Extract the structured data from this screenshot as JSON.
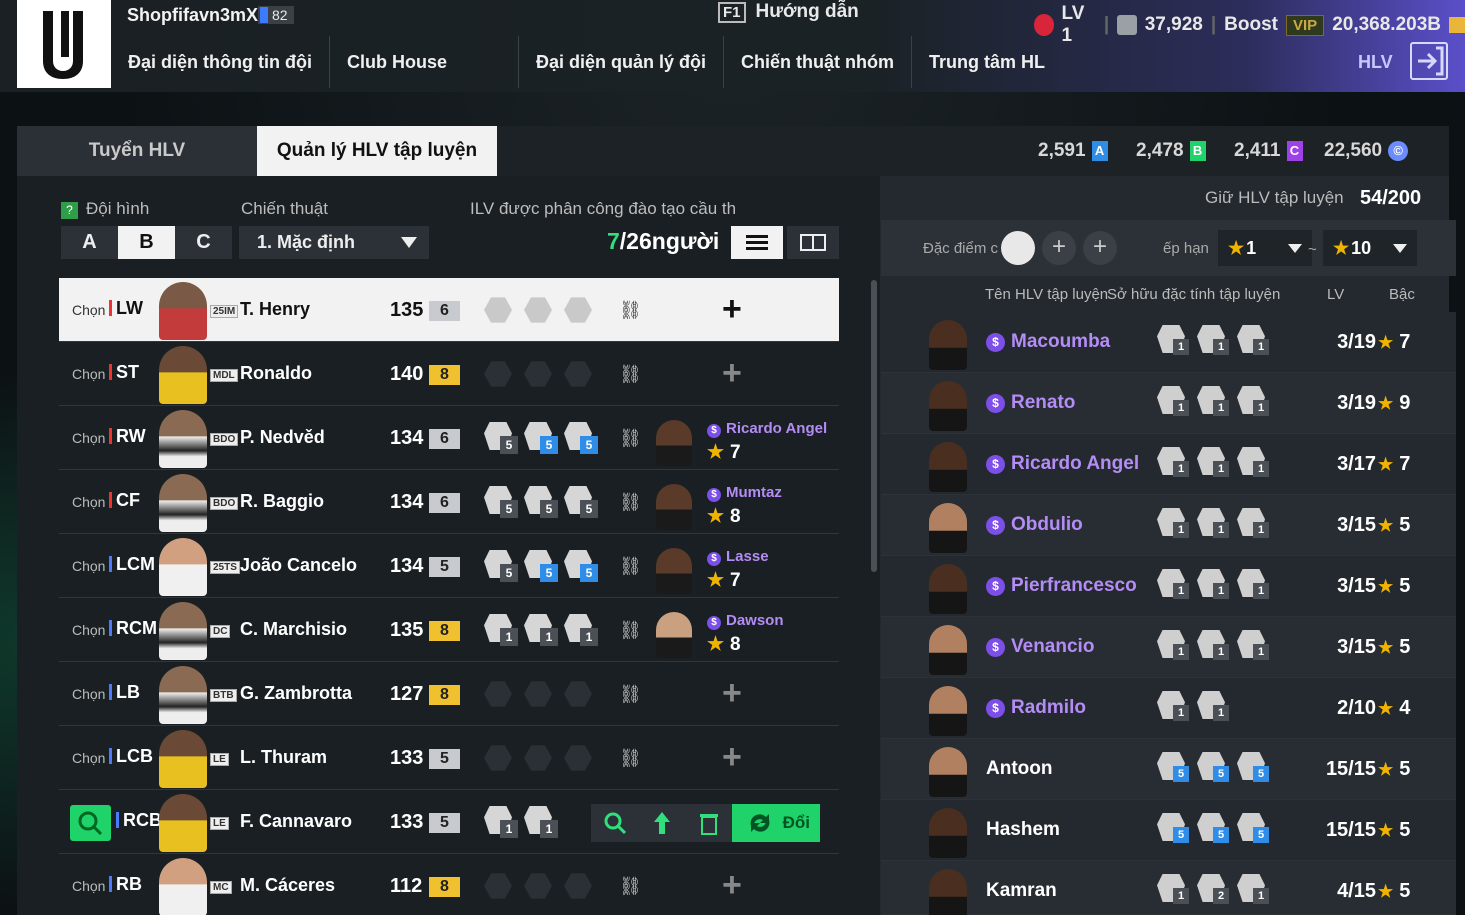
{
  "header": {
    "team_name": "Shopfifavn3mXr",
    "team_level": "82",
    "guide_key": "F1",
    "guide_label": "Hướng dẫn",
    "lv": "LV 1",
    "trophies": "37,928",
    "boost": "Boost",
    "vip": "VIP",
    "coins": "20,368.203B",
    "coach_label": "HLV"
  },
  "menu": [
    "Đại diện thông tin đội",
    "Club House",
    "Đại diện quản lý đội",
    "Chiến thuật nhóm",
    "Trung tâm HL"
  ],
  "tabs": [
    "Tuyển HLV",
    "Quản lý HLV tập luyện"
  ],
  "currencies": [
    {
      "value": "2,591",
      "code": "A",
      "color": "#2f8de8"
    },
    {
      "value": "2,478",
      "code": "B",
      "color": "#1fd26a"
    },
    {
      "value": "2,411",
      "code": "C",
      "color": "#a040e8"
    },
    {
      "value": "22,560",
      "code": "©",
      "color": "#6a8cff"
    }
  ],
  "left": {
    "formation_label": "Đội hình",
    "formation_help": "?",
    "tactic_label": "Chiến thuật",
    "assign_label": "ILV được phân công đào tạo cầu th",
    "formations": [
      "A",
      "B",
      "C"
    ],
    "tactic_value": "1. Mặc định",
    "count_current": "7",
    "count_rest": "/26người",
    "choose": "Chọn"
  },
  "rows": [
    {
      "pos": "LW",
      "season": "25IM",
      "name": "T. Henry",
      "ovr": "135",
      "lvl": "6"
    },
    {
      "pos": "ST",
      "season": "MDL",
      "name": "Ronaldo",
      "ovr": "140",
      "lvl": "8"
    },
    {
      "pos": "RW",
      "season": "BDO",
      "name": "P. Nedvěd",
      "ovr": "134",
      "lvl": "6",
      "traits": [
        "5",
        "5",
        "5"
      ],
      "coach": "Ricardo Angel",
      "cstar": "7"
    },
    {
      "pos": "CF",
      "season": "BDO",
      "name": "R. Baggio",
      "ovr": "134",
      "lvl": "6",
      "traits": [
        "5",
        "5",
        "5"
      ],
      "coach": "Mumtaz",
      "cstar": "8"
    },
    {
      "pos": "LCM",
      "season": "25TS",
      "name": "João Cancelo",
      "ovr": "134",
      "lvl": "5",
      "traits": [
        "5",
        "5",
        "5"
      ],
      "coach": "Lasse",
      "cstar": "7"
    },
    {
      "pos": "RCM",
      "season": "DC",
      "name": "C. Marchisio",
      "ovr": "135",
      "lvl": "8",
      "traits": [
        "1",
        "1",
        "1"
      ],
      "coach": "Dawson",
      "cstar": "8"
    },
    {
      "pos": "LB",
      "season": "BTB",
      "name": "G. Zambrotta",
      "ovr": "127",
      "lvl": "8"
    },
    {
      "pos": "LCB",
      "season": "LE",
      "name": "L. Thuram",
      "ovr": "133",
      "lvl": "5"
    },
    {
      "pos": "RCB",
      "season": "LE",
      "name": "F. Cannavaro",
      "ovr": "133",
      "lvl": "5",
      "traits": [
        "1",
        "1"
      ]
    },
    {
      "pos": "RB",
      "season": "MC",
      "name": "M. Cáceres",
      "ovr": "112",
      "lvl": "8"
    }
  ],
  "action": {
    "swap_label": "Đổi"
  },
  "right": {
    "slot_label": "Giữ HLV tập luyện",
    "slot_value": "54/200",
    "trait_label": "Đặc điểm c",
    "rank_label": "ếp hạn",
    "rank_from": "1",
    "rank_sep": "~",
    "rank_to": "10",
    "col_name": "Tên HLV tập luyện",
    "col_traits": "Sở hữu đặc tính tập luyện",
    "col_lv": "LV",
    "col_rank": "Bậc"
  },
  "coaches": [
    {
      "name": "Macoumba",
      "special": true,
      "traits": [
        "1",
        "1",
        "1"
      ],
      "lv": "3/19",
      "star": "7"
    },
    {
      "name": "Renato",
      "special": true,
      "traits": [
        "1",
        "1",
        "1"
      ],
      "lv": "3/19",
      "star": "9"
    },
    {
      "name": "Ricardo Angel",
      "special": true,
      "traits": [
        "1",
        "1",
        "1"
      ],
      "lv": "3/17",
      "star": "7"
    },
    {
      "name": "Obdulio",
      "special": true,
      "traits": [
        "1",
        "1",
        "1"
      ],
      "lv": "3/15",
      "star": "5"
    },
    {
      "name": "Pierfrancesco",
      "special": true,
      "traits": [
        "1",
        "1",
        "1"
      ],
      "lv": "3/15",
      "star": "5"
    },
    {
      "name": "Venancio",
      "special": true,
      "traits": [
        "1",
        "1",
        "1"
      ],
      "lv": "3/15",
      "star": "5"
    },
    {
      "name": "Radmilo",
      "special": true,
      "traits": [
        "1",
        "1"
      ],
      "lv": "2/10",
      "star": "4"
    },
    {
      "name": "Antoon",
      "special": false,
      "traits": [
        "5",
        "5",
        "5"
      ],
      "lv": "15/15",
      "star": "5"
    },
    {
      "name": "Hashem",
      "special": false,
      "traits": [
        "5",
        "5",
        "5"
      ],
      "lv": "15/15",
      "star": "5"
    },
    {
      "name": "Kamran",
      "special": false,
      "traits": [
        "1",
        "2",
        "1"
      ],
      "lv": "4/15",
      "star": "5"
    }
  ]
}
